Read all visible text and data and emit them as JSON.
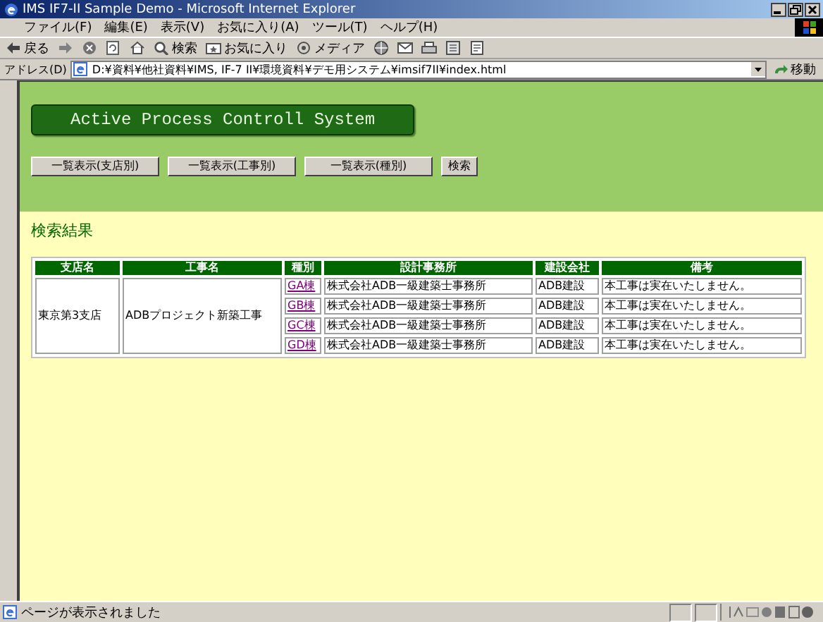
{
  "window": {
    "title": "IMS IF7-II Sample Demo - Microsoft Internet Explorer"
  },
  "menu": [
    "ファイル(F)",
    "編集(E)",
    "表示(V)",
    "お気に入り(A)",
    "ツール(T)",
    "ヘルプ(H)"
  ],
  "toolbar": [
    {
      "kind": "back",
      "label": "戻る"
    },
    {
      "kind": "forward"
    },
    {
      "kind": "stop"
    },
    {
      "kind": "refresh"
    },
    {
      "kind": "home"
    },
    {
      "kind": "search",
      "label": "検索"
    },
    {
      "kind": "favorites",
      "label": "お気に入り"
    },
    {
      "kind": "media",
      "label": "メディア"
    },
    {
      "kind": "history"
    },
    {
      "kind": "mail"
    },
    {
      "kind": "print"
    },
    {
      "kind": "edit"
    },
    {
      "kind": "discuss"
    }
  ],
  "address": {
    "label": "アドレス(D)",
    "value": "D:¥資料¥他社資料¥IMS, IF-7 II¥環境資料¥デモ用システム¥imsif7II¥index.html",
    "go": "移動"
  },
  "page": {
    "banner": "Active Process Controll System",
    "buttons": [
      "一覧表示(支店別)",
      "一覧表示(工事別)",
      "一覧表示(種別)",
      "検索"
    ],
    "heading": "検索結果",
    "table": {
      "columns": [
        "支店名",
        "工事名",
        "種別",
        "設計事務所",
        "建設会社",
        "備考"
      ],
      "groups": [
        {
          "branch": "東京第3支店",
          "project": "ADBプロジェクト新築工事",
          "rows": [
            {
              "type": "GA棟",
              "designer": "株式会社ADB一級建築士事務所",
              "contractor": "ADB建設",
              "note": "本工事は実在いたしません。"
            },
            {
              "type": "GB棟",
              "designer": "株式会社ADB一級建築士事務所",
              "contractor": "ADB建設",
              "note": "本工事は実在いたしません。"
            },
            {
              "type": "GC棟",
              "designer": "株式会社ADB一級建築士事務所",
              "contractor": "ADB建設",
              "note": "本工事は実在いたしません。"
            },
            {
              "type": "GD棟",
              "designer": "株式会社ADB一級建築士事務所",
              "contractor": "ADB建設",
              "note": "本工事は実在いたしません。"
            }
          ]
        }
      ]
    }
  },
  "status_bar": {
    "text": "ページが表示されました"
  }
}
